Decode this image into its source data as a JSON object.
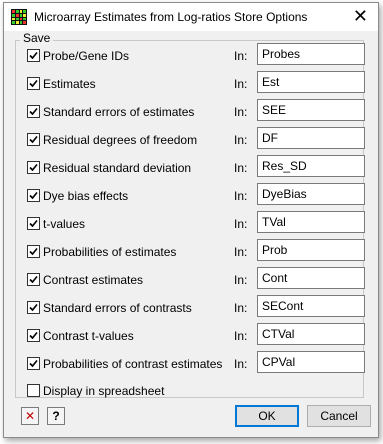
{
  "window": {
    "title": "Microarray Estimates from Log-ratios Store Options",
    "close_glyph": "✕"
  },
  "group": {
    "label": "Save"
  },
  "in_label": "In:",
  "rows": [
    {
      "label": "Probe/Gene IDs",
      "checked": true,
      "value": "Probes"
    },
    {
      "label": "Estimates",
      "checked": true,
      "value": "Est"
    },
    {
      "label": "Standard errors of estimates",
      "checked": true,
      "value": "SEE"
    },
    {
      "label": "Residual degrees of freedom",
      "checked": true,
      "value": "DF"
    },
    {
      "label": "Residual standard deviation",
      "checked": true,
      "value": "Res_SD"
    },
    {
      "label": "Dye bias effects",
      "checked": true,
      "value": "DyeBias"
    },
    {
      "label": "t-values",
      "checked": true,
      "value": "TVal"
    },
    {
      "label": "Probabilities of estimates",
      "checked": true,
      "value": "Prob"
    },
    {
      "label": "Contrast estimates",
      "checked": true,
      "value": "Cont"
    },
    {
      "label": "Standard errors of contrasts",
      "checked": true,
      "value": "SECont"
    },
    {
      "label": "Contrast t-values",
      "checked": true,
      "value": "CTVal"
    },
    {
      "label": "Probabilities of contrast estimates",
      "checked": true,
      "value": "CPVal"
    }
  ],
  "display_spreadsheet": {
    "label": "Display in spreadsheet",
    "checked": false
  },
  "buttons": {
    "clear_glyph": "✕",
    "help_glyph": "?",
    "ok": "OK",
    "cancel": "Cancel"
  },
  "colors": {
    "clear_red": "#c00000",
    "default_border": "#0078d7"
  }
}
